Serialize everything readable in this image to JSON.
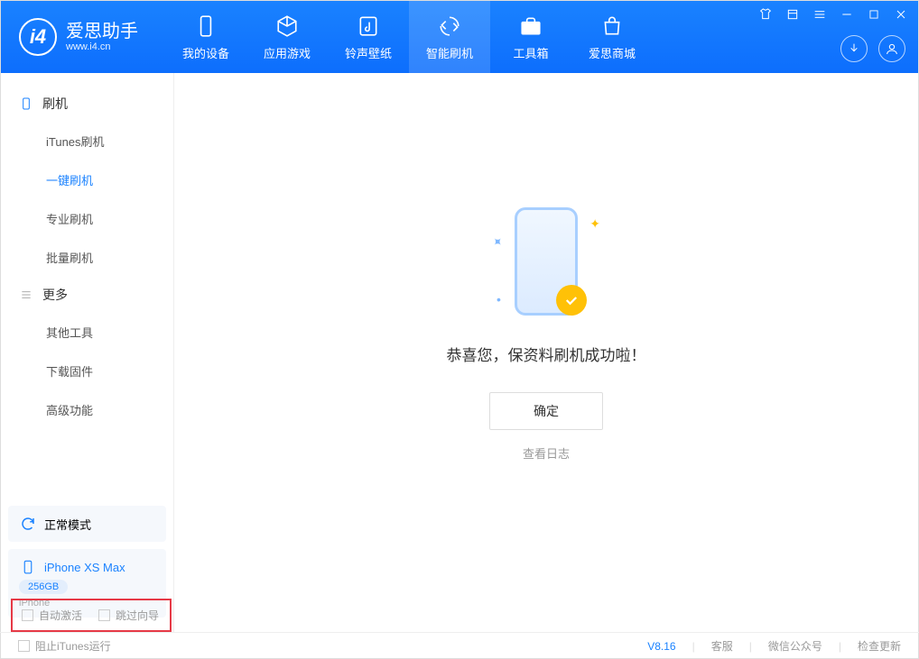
{
  "app": {
    "name_cn": "爱思助手",
    "url": "www.i4.cn"
  },
  "tabs": [
    {
      "label": "我的设备"
    },
    {
      "label": "应用游戏"
    },
    {
      "label": "铃声壁纸"
    },
    {
      "label": "智能刷机"
    },
    {
      "label": "工具箱"
    },
    {
      "label": "爱思商城"
    }
  ],
  "sidebar": {
    "section1": {
      "title": "刷机"
    },
    "items1": [
      {
        "label": "iTunes刷机"
      },
      {
        "label": "一键刷机"
      },
      {
        "label": "专业刷机"
      },
      {
        "label": "批量刷机"
      }
    ],
    "section2": {
      "title": "更多"
    },
    "items2": [
      {
        "label": "其他工具"
      },
      {
        "label": "下载固件"
      },
      {
        "label": "高级功能"
      }
    ],
    "mode": "正常模式",
    "device": {
      "name": "iPhone XS Max",
      "capacity": "256GB",
      "type": "iPhone"
    }
  },
  "main": {
    "success": "恭喜您，保资料刷机成功啦！",
    "ok": "确定",
    "view_log": "查看日志"
  },
  "options": {
    "auto_activate": "自动激活",
    "skip_guide": "跳过向导"
  },
  "footer": {
    "block_itunes": "阻止iTunes运行",
    "version": "V8.16",
    "support": "客服",
    "wechat": "微信公众号",
    "update": "检查更新"
  }
}
